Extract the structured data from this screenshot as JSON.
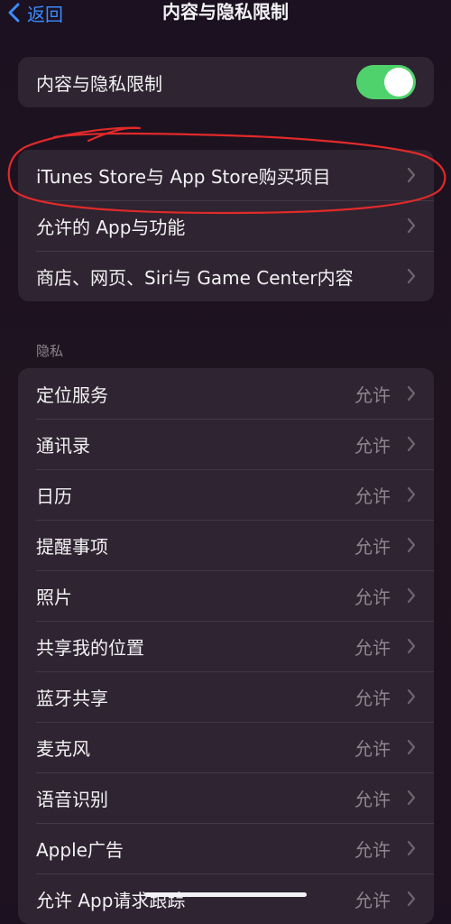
{
  "nav": {
    "back_label": "返回",
    "title": "内容与隐私限制"
  },
  "toggle_group": {
    "label": "内容与隐私限制",
    "enabled": true
  },
  "restrictions": [
    {
      "label": "iTunes Store与 App Store购买项目"
    },
    {
      "label": "允许的 App与功能"
    },
    {
      "label": "商店、网页、Siri与 Game Center内容"
    }
  ],
  "privacy": {
    "header": "隐私",
    "items": [
      {
        "label": "定位服务",
        "value": "允许"
      },
      {
        "label": "通讯录",
        "value": "允许"
      },
      {
        "label": "日历",
        "value": "允许"
      },
      {
        "label": "提醒事项",
        "value": "允许"
      },
      {
        "label": "照片",
        "value": "允许"
      },
      {
        "label": "共享我的位置",
        "value": "允许"
      },
      {
        "label": "蓝牙共享",
        "value": "允许"
      },
      {
        "label": "麦克风",
        "value": "允许"
      },
      {
        "label": "语音识别",
        "value": "允许"
      },
      {
        "label": "Apple广告",
        "value": "允许"
      },
      {
        "label": "允许 App请求跟踪",
        "value": "允许"
      }
    ]
  },
  "colors": {
    "accent": "#3b8cff",
    "toggle_on": "#4fd26b",
    "annotation": "#e02a2a"
  }
}
